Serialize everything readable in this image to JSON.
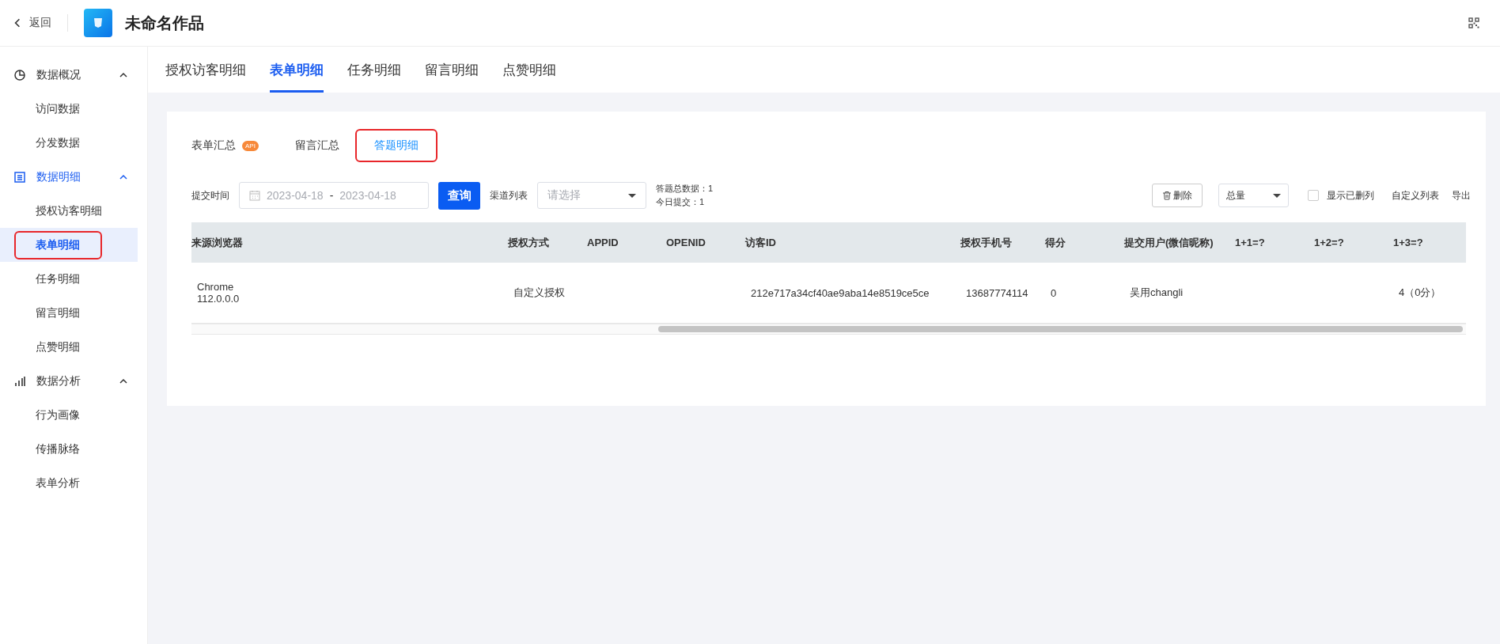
{
  "header": {
    "back": "返回",
    "title": "未命名作品"
  },
  "sidebar": {
    "groups": [
      {
        "title": "数据概况",
        "expanded": true,
        "selected": false,
        "items": [
          {
            "label": "访问数据",
            "selected": false,
            "highlighted": false
          },
          {
            "label": "分发数据",
            "selected": false,
            "highlighted": false
          }
        ]
      },
      {
        "title": "数据明细",
        "expanded": true,
        "selected": true,
        "items": [
          {
            "label": "授权访客明细",
            "selected": false,
            "highlighted": false
          },
          {
            "label": "表单明细",
            "selected": true,
            "highlighted": true
          },
          {
            "label": "任务明细",
            "selected": false,
            "highlighted": false
          },
          {
            "label": "留言明细",
            "selected": false,
            "highlighted": false
          },
          {
            "label": "点赞明细",
            "selected": false,
            "highlighted": false
          }
        ]
      },
      {
        "title": "数据分析",
        "expanded": true,
        "selected": false,
        "items": [
          {
            "label": "行为画像",
            "selected": false,
            "highlighted": false
          },
          {
            "label": "传播脉络",
            "selected": false,
            "highlighted": false
          },
          {
            "label": "表单分析",
            "selected": false,
            "highlighted": false
          }
        ]
      }
    ]
  },
  "tabs": [
    {
      "label": "授权访客明细",
      "selected": false
    },
    {
      "label": "表单明细",
      "selected": true
    },
    {
      "label": "任务明细",
      "selected": false
    },
    {
      "label": "留言明细",
      "selected": false
    },
    {
      "label": "点赞明细",
      "selected": false
    }
  ],
  "subtabs": [
    {
      "label": "表单汇总",
      "badge": "API",
      "selected": false,
      "highlighted": false
    },
    {
      "label": "留言汇总",
      "selected": false,
      "highlighted": false
    },
    {
      "label": "答题明细",
      "selected": true,
      "highlighted": true
    }
  ],
  "filters": {
    "time_label": "提交时间",
    "date_start": "2023-04-18",
    "date_separator": "-",
    "date_end": "2023-04-18",
    "query_button": "查询",
    "channel_label": "渠道列表",
    "channel_placeholder": "请选择",
    "stats": [
      "答题总数据：1",
      "今日提交：1"
    ],
    "delete_button": "删除",
    "total_select": "总量",
    "show_deleted": {
      "label": "显示已删列",
      "checked": false
    },
    "custom_columns": "自定义列表",
    "export": "导出"
  },
  "table": {
    "columns": [
      "来源浏览器",
      "授权方式",
      "APPID",
      "OPENID",
      "访客ID",
      "授权手机号",
      "得分",
      "提交用户(微信昵称)",
      "1+1=?",
      "1+2=?",
      "1+3=?"
    ],
    "rows": [
      [
        "Chrome\n112.0.0.0",
        "自定义授权",
        "",
        "",
        "212e717a34cf40ae9aba14e8519ce5ce",
        "13687774114",
        "0",
        "吴用changli",
        "",
        "",
        "4（0分）"
      ]
    ]
  }
}
